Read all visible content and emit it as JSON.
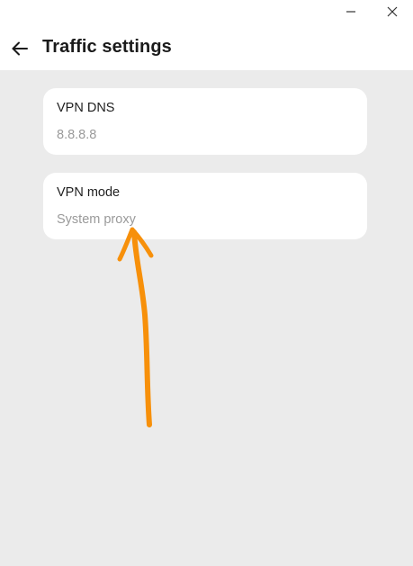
{
  "window": {
    "minimize_icon": "minimize-icon",
    "close_icon": "close-icon"
  },
  "header": {
    "back_icon": "arrow-left-icon",
    "title": "Traffic settings"
  },
  "settings": {
    "vpn_dns": {
      "label": "VPN DNS",
      "value": "8.8.8.8"
    },
    "vpn_mode": {
      "label": "VPN mode",
      "value": "System proxy"
    }
  },
  "annotation": {
    "type": "hand-drawn-arrow",
    "color": "#f7900a",
    "points_to": "vpn-mode-value"
  }
}
